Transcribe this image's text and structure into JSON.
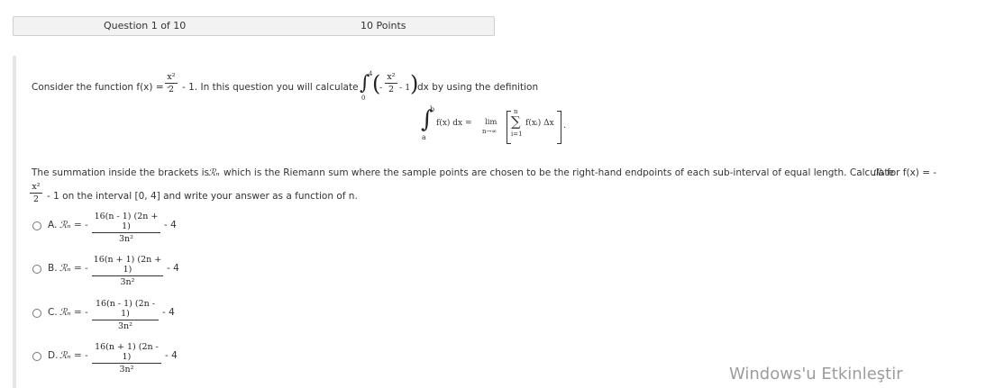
{
  "header": {
    "question_label": "Question 1 of 10",
    "points_label": "10 Points"
  },
  "prompt": {
    "line1_start": "Consider the function f(x) = -",
    "fx_num": "x²",
    "fx_den": "2",
    "line1_mid": "- 1. In this question you will calculate",
    "integral_upper": "4",
    "integral_lower": "0",
    "int_minus": "-",
    "int_num": "x²",
    "int_den": "2",
    "int_tail": "- 1",
    "line1_end": "dx by using the definition",
    "def_upper": "b",
    "def_lower": "a",
    "def_integrand": "f(x)  dx =",
    "def_lim": "lim",
    "def_lim_sub": "n→∞",
    "def_sum_upper": "n",
    "def_sum_lower": "i=1",
    "def_sum_body": "f(xᵢ) Δx",
    "def_end": "."
  },
  "paragraph": {
    "line2_start": "The summation inside the brackets is",
    "rn_symbol": "ℛₙ",
    "line2_mid": "which is the Riemann sum where the sample points are chosen to be the right-hand endpoints of each sub-interval of equal length. Calculate",
    "line2_end": "for f(x) = -",
    "frac_num": "x²",
    "frac_den": "2",
    "line3": "- 1 on the interval [0, 4] and write your answer as a function of n."
  },
  "options": [
    {
      "letter": "A.",
      "lhs": "ℛₙ = -",
      "num": "16(n - 1) (2n + 1)",
      "den": "3n²",
      "tail": "- 4"
    },
    {
      "letter": "B.",
      "lhs": "ℛₙ = -",
      "num": "16(n + 1) (2n + 1)",
      "den": "3n²",
      "tail": "- 4"
    },
    {
      "letter": "C.",
      "lhs": "ℛₙ = -",
      "num": "16(n - 1) (2n - 1)",
      "den": "3n²",
      "tail": "- 4"
    },
    {
      "letter": "D.",
      "lhs": "ℛₙ = -",
      "num": "16(n + 1) (2n - 1)",
      "den": "3n²",
      "tail": "- 4"
    }
  ],
  "watermark": "Windows'u Etkinleştir"
}
